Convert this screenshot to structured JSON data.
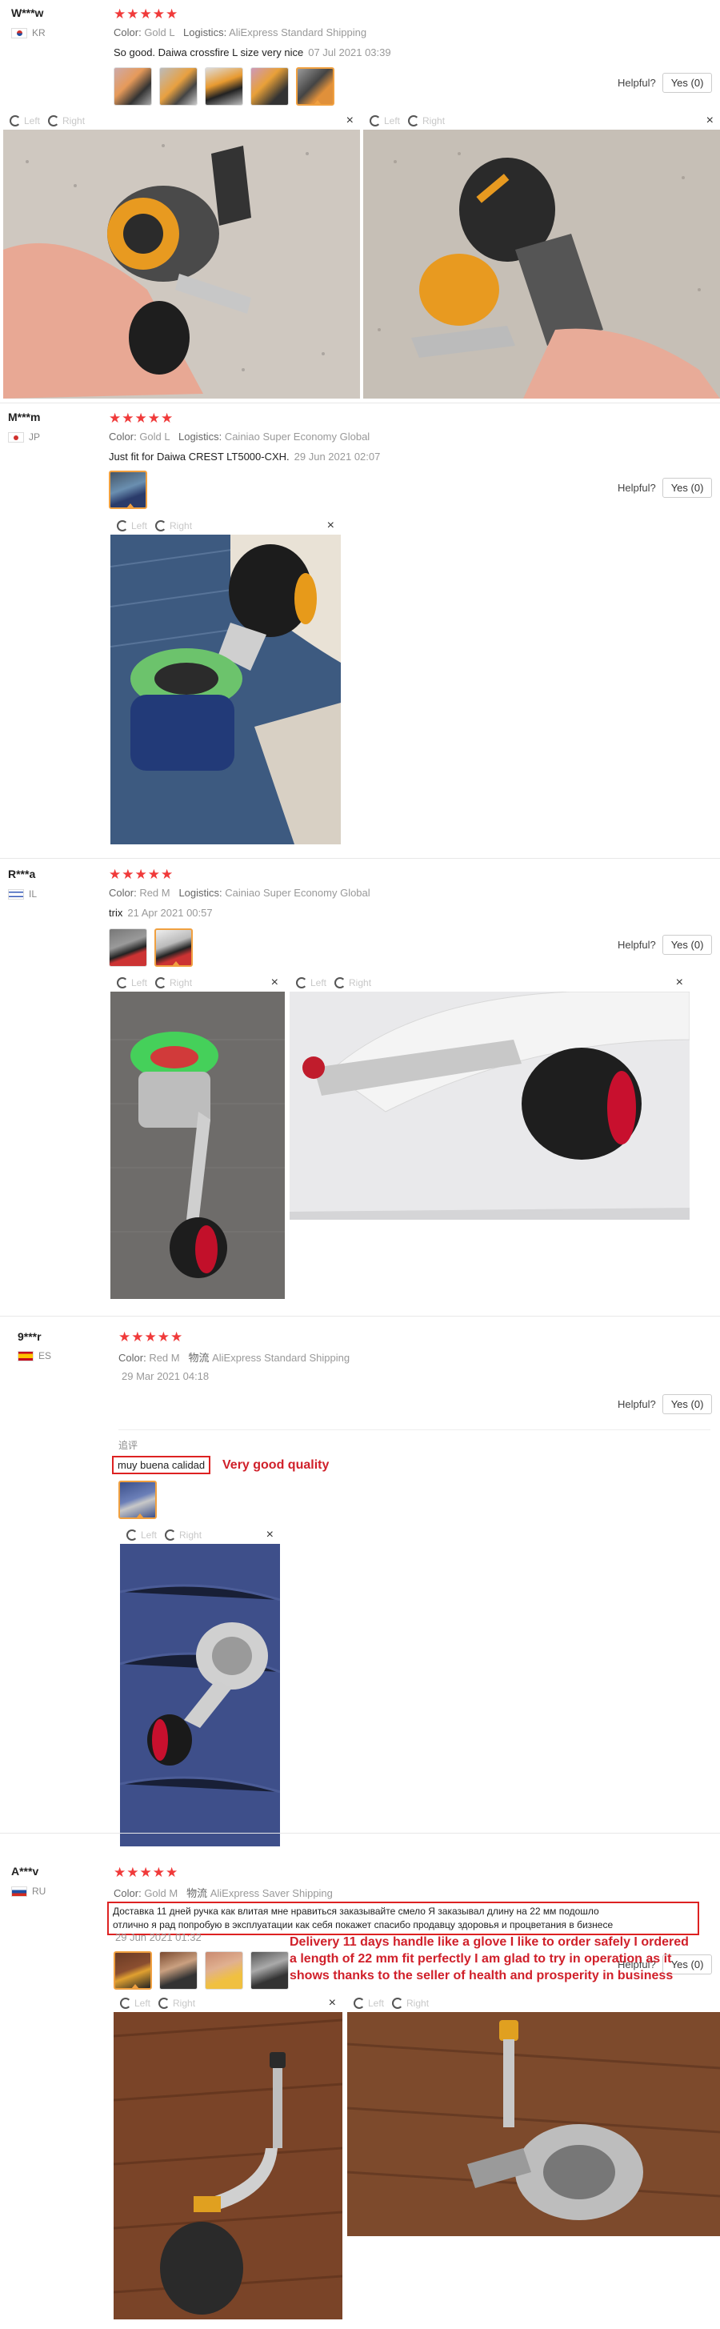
{
  "viewer": {
    "left_label": "Left",
    "right_label": "Right",
    "close": "×"
  },
  "helpful_label": "Helpful?",
  "yes_label": "Yes (0)",
  "reviews": [
    {
      "user": "W***w",
      "country": "KR",
      "stars": "★★★★★",
      "color_label": "Color:",
      "color_value": "Gold L",
      "logistics_label": "Logistics:",
      "logistics_value": "AliExpress Standard Shipping",
      "text": "So good. Daiwa crossfire L size very nice",
      "date": "07 Jul 2021 03:39"
    },
    {
      "user": "M***m",
      "country": "JP",
      "stars": "★★★★★",
      "color_label": "Color:",
      "color_value": "Gold L",
      "logistics_label": "Logistics:",
      "logistics_value": "Cainiao Super Economy Global",
      "text": "Just fit for Daiwa CREST LT5000-CXH.",
      "date": "29 Jun 2021 02:07"
    },
    {
      "user": "R***a",
      "country": "IL",
      "stars": "★★★★★",
      "color_label": "Color:",
      "color_value": "Red M",
      "logistics_label": "Logistics:",
      "logistics_value": "Cainiao Super Economy Global",
      "text": "trix",
      "date": "21 Apr 2021 00:57"
    },
    {
      "user": "9***r",
      "country": "ES",
      "stars": "★★★★★",
      "color_label": "Color:",
      "color_value": "Red M",
      "logistics_label": "物流",
      "logistics_value": "AliExpress Standard Shipping",
      "date": "29 Mar 2021 04:18",
      "section_label": "追评",
      "original_text": "muy buena calidad",
      "translation": "Very good quality"
    },
    {
      "user": "A***v",
      "country": "RU",
      "stars": "★★★★★",
      "color_label": "Color:",
      "color_value": "Gold M",
      "logistics_label": "物流",
      "logistics_value": "AliExpress Saver Shipping",
      "original_line1": "Доставка 11 дней ручка как влитая мне нравиться заказывайте смело Я заказывал длину на 22 мм подошло",
      "original_line2": "отлично я рад попробую в эксплуатации как себя покажет спасибо продавцу здоровья и процветания в бизнесе",
      "date": "29 Jun 2021 01:32",
      "translation_line1": "Delivery 11 days handle like a glove I like to order safely I ordered",
      "translation_line2": "a length of 22 mm fit perfectly I am glad to try in operation as it",
      "translation_line3": "shows thanks to the seller of health and prosperity in business"
    }
  ]
}
